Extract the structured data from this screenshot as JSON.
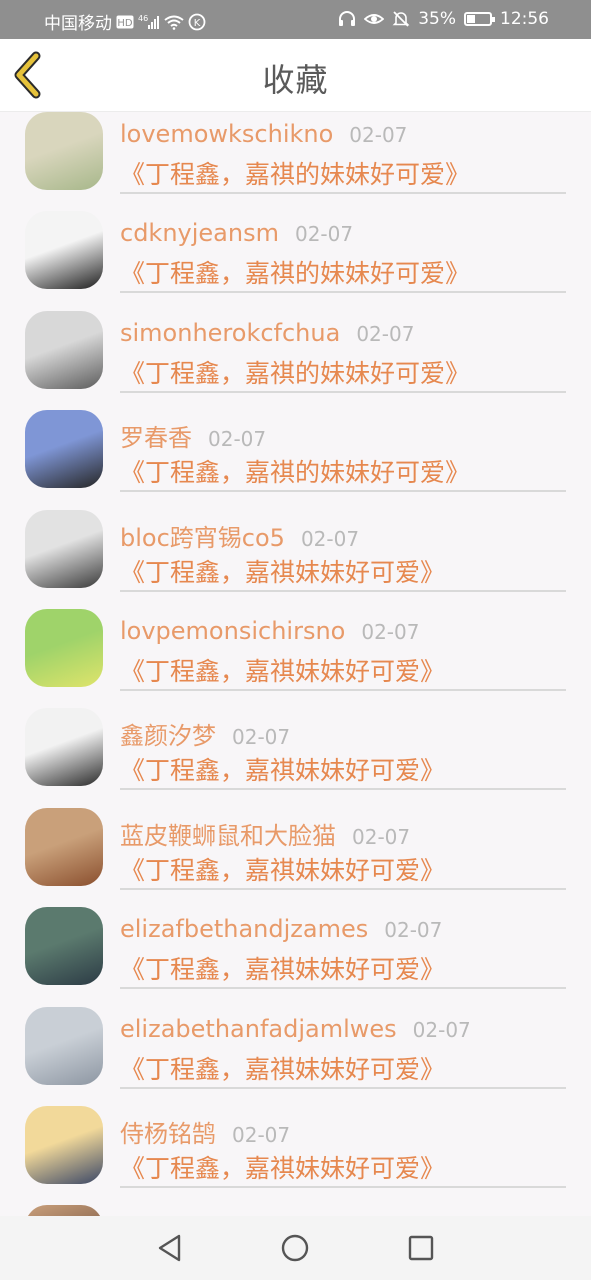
{
  "status_bar": {
    "carrier": "中国移动",
    "network_badge": "HD",
    "network_type": "⁴⁶",
    "battery": "35%",
    "battery_level": 0.35,
    "time": "12:56",
    "icons": [
      "hd-icon",
      "signal-icon",
      "wifi-icon",
      "k-icon",
      "headphone-icon",
      "eye-icon",
      "mute-bell-icon",
      "battery-icon"
    ]
  },
  "header": {
    "title": "收藏",
    "back_icon": "chevron-left-icon"
  },
  "list": {
    "items": [
      {
        "name": "lovemowkschikno",
        "date": "02-07",
        "title": "《丁程鑫，嘉祺的妹妹好可爱》",
        "avatar_colors": [
          "#d9d6bd",
          "#a7b78a"
        ]
      },
      {
        "name": "cdknyjeansm",
        "date": "02-07",
        "title": "《丁程鑫，嘉祺的妹妹好可爱》",
        "avatar_colors": [
          "#f4f4f4",
          "#1e1e1e"
        ]
      },
      {
        "name": "simonherokcfchua",
        "date": "02-07",
        "title": "《丁程鑫，嘉祺的妹妹好可爱》",
        "avatar_colors": [
          "#d8d8d8",
          "#5c5c5c"
        ]
      },
      {
        "name": "罗春香",
        "date": "02-07",
        "title": "《丁程鑫，嘉祺的妹妹好可爱》",
        "avatar_colors": [
          "#7f96d6",
          "#262626"
        ]
      },
      {
        "name": "bloc跨宵锡co5",
        "date": "02-07",
        "title": "《丁程鑫，嘉祺妹妹好可爱》",
        "avatar_colors": [
          "#e2e2e2",
          "#3a3a3a"
        ]
      },
      {
        "name": "lovpemonsichirsno",
        "date": "02-07",
        "title": "《丁程鑫，嘉祺妹妹好可爱》",
        "avatar_colors": [
          "#9fd36a",
          "#dfe46b"
        ]
      },
      {
        "name": "鑫颜汐梦",
        "date": "02-07",
        "title": "《丁程鑫，嘉祺妹妹好可爱》",
        "avatar_colors": [
          "#f2f2f2",
          "#2a2a2a"
        ]
      },
      {
        "name": "蓝皮鞭蛳鼠和大脸猫",
        "date": "02-07",
        "title": "《丁程鑫，嘉祺妹妹好可爱》",
        "avatar_colors": [
          "#c9a07a",
          "#8a4f2e"
        ]
      },
      {
        "name": "elizafbethandjzames",
        "date": "02-07",
        "title": "《丁程鑫，嘉祺妹妹好可爱》",
        "avatar_colors": [
          "#5b7a6e",
          "#2c3b45"
        ]
      },
      {
        "name": "elizabethanfadjamlwes",
        "date": "02-07",
        "title": "《丁程鑫，嘉祺妹妹好可爱》",
        "avatar_colors": [
          "#c9cfd6",
          "#8d96a2"
        ]
      },
      {
        "name": "侍杨铭鹄",
        "date": "02-07",
        "title": "《丁程鑫，嘉祺妹妹好可爱》",
        "avatar_colors": [
          "#f2d99a",
          "#3b4766"
        ]
      }
    ],
    "partial_avatar_colors": [
      "#caa07c",
      "#4a2e22"
    ]
  },
  "nav_bar": {
    "icons": [
      "back-triangle-icon",
      "home-circle-icon",
      "recents-square-icon"
    ]
  },
  "colors": {
    "accent_name": "#e89a69",
    "accent_title": "#e6884f",
    "date": "#b9b9b9",
    "back_chevron": "#e6c23a",
    "background": "#f8f6f8"
  }
}
